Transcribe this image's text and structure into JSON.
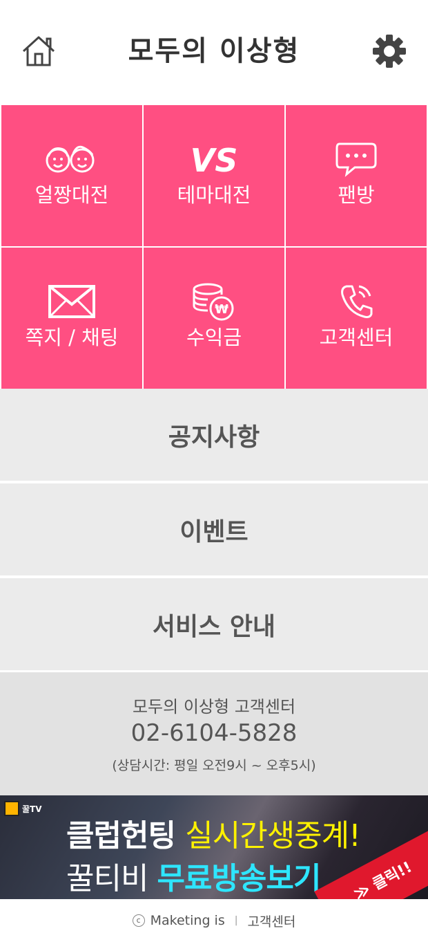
{
  "header": {
    "title": "모두의 이상형"
  },
  "tiles": [
    {
      "label": "얼짱대전"
    },
    {
      "label": "테마대전"
    },
    {
      "label": "팬방"
    },
    {
      "label": "쪽지 / 채팅"
    },
    {
      "label": "수익금"
    },
    {
      "label": "고객센터"
    }
  ],
  "menu": [
    {
      "label": "공지사항"
    },
    {
      "label": "이벤트"
    },
    {
      "label": "서비스 안내"
    }
  ],
  "customer_service": {
    "title": "모두의 이상형 고객센터",
    "phone": "02-6104-5828",
    "hours": "(상담시간: 평일 오전9시 ~ 오후5시)"
  },
  "banner": {
    "logo_text": "꿀TV",
    "line1_a": "클럽헌팅 ",
    "line1_b": "실시간생중계",
    "line1_c": "!",
    "line2_a": "꿀티비 ",
    "line2_b": "무료방송보기",
    "cta": "≫ 클릭!!"
  },
  "footer": {
    "copyright_symbol": "c",
    "company": "Maketing is",
    "separator": "|",
    "link": "고객센터"
  },
  "colors": {
    "tile": "#ff4f82",
    "menu_bg": "#ebebeb",
    "cs_bg": "#e2e2e2"
  }
}
